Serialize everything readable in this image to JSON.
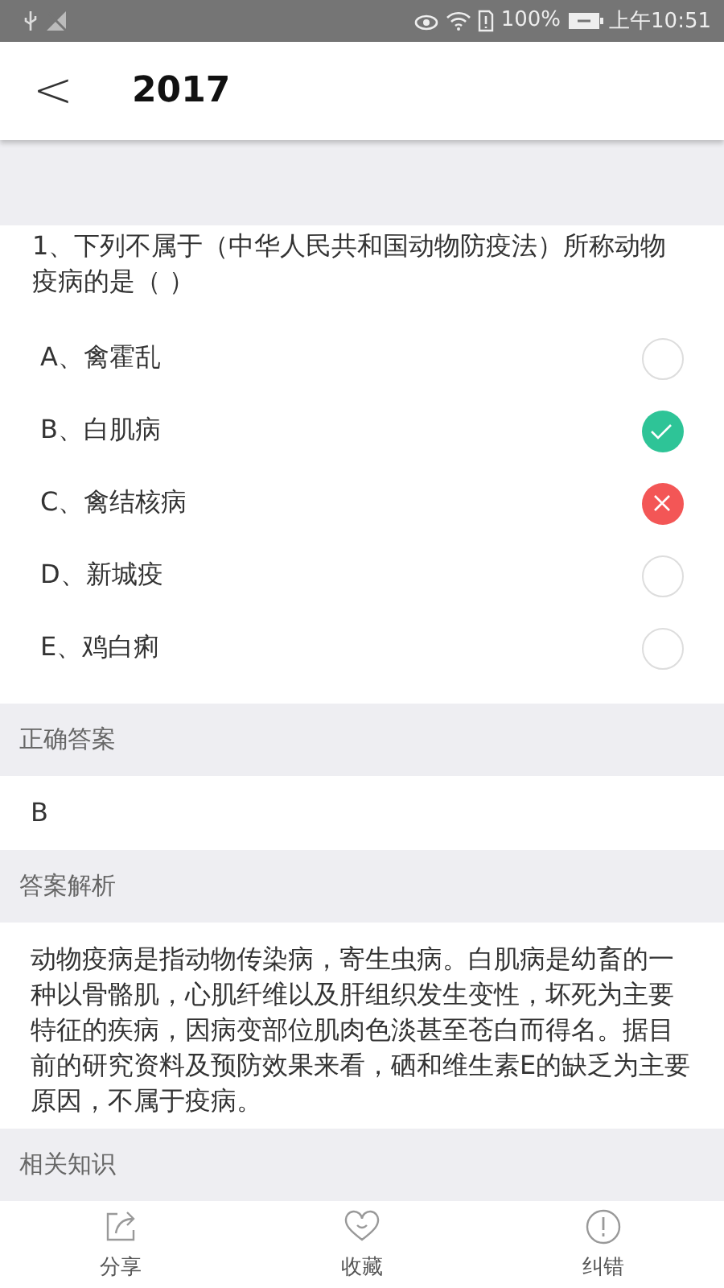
{
  "status_bar": {
    "battery_percent": "100%",
    "time": "上午10:51"
  },
  "header": {
    "back": "<",
    "title": "2017"
  },
  "question": {
    "text": "1、下列不属于（中华人民共和国动物防疫法）所称动物疫病的是（ ）",
    "options": [
      {
        "kind": "plain",
        "label": "A、禽霍乱"
      },
      {
        "kind": "correct",
        "label": "B、白肌病"
      },
      {
        "kind": "wrong",
        "label": "C、禽结核病"
      },
      {
        "kind": "plain",
        "label": "D、新城疫"
      },
      {
        "kind": "plain",
        "label": "E、鸡白痢"
      }
    ]
  },
  "sections": [
    {
      "heading": "正确答案",
      "body": "B"
    },
    {
      "heading": "答案解析",
      "body": "动物疫病是指动物传染病，寄生虫病。白肌病是幼畜的一种以骨骼肌，心肌纤维以及肝组织发生变性，坏死为主要特征的疾病，因病变部位肌肉色淡甚至苍白而得名。据目前的研究资料及预防效果来看，硒和维生素E的缺乏为主要原因，不属于疫病。"
    },
    {
      "heading": "相关知识"
    }
  ],
  "bottom_nav": [
    {
      "kind": "share",
      "label": "分享"
    },
    {
      "kind": "favorite",
      "label": "收藏"
    },
    {
      "kind": "report",
      "label": "纠错"
    }
  ]
}
